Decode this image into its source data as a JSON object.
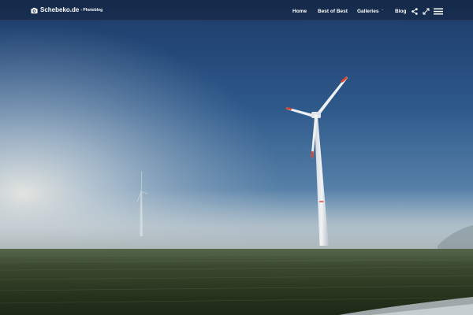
{
  "site": {
    "name": "Schebeko.de",
    "tagline": "- Photoblog"
  },
  "nav": {
    "items": [
      {
        "label": "Home"
      },
      {
        "label": "Best of Best"
      },
      {
        "label": "Galleries",
        "has_dropdown": true
      },
      {
        "label": "Blog"
      }
    ],
    "caret": "ˇ"
  },
  "icons": {
    "brand": "camera-icon",
    "share": "share-icon",
    "fullscreen": "expand-icon",
    "menu": "hamburger-menu-icon"
  },
  "colors": {
    "navbar": "#162c4c",
    "sky_top": "#1d3d6c",
    "sky_mid": "#3f6f9e",
    "fog": "#c9d3d8",
    "field": "#2c3a22",
    "turbine_accent": "#d9442f"
  }
}
